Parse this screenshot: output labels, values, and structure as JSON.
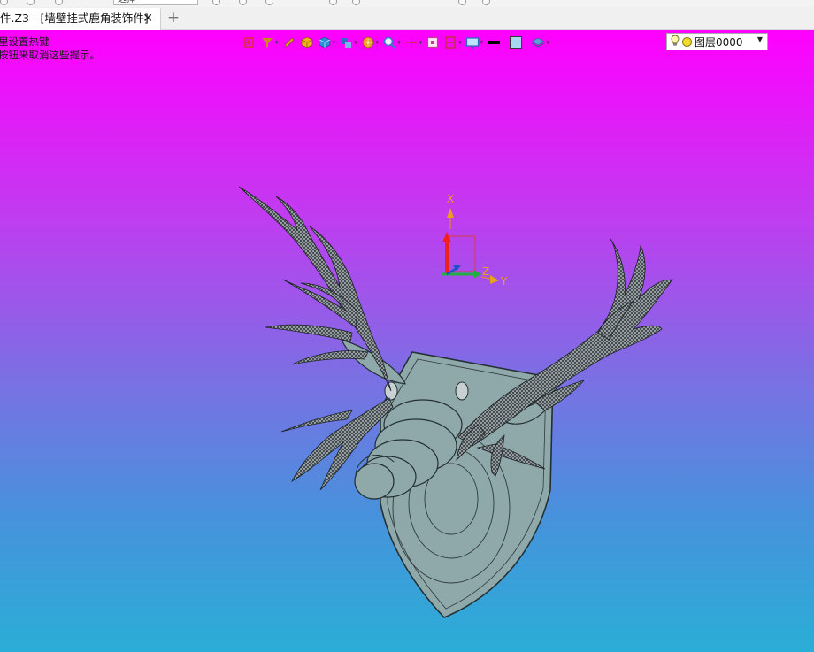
{
  "tab": {
    "title": "件.Z3 - [墙壁挂式鹿角装饰件]",
    "close_glyph": "✕",
    "new_glyph": "+"
  },
  "quickbar": {
    "box_text": "选择"
  },
  "hints": {
    "line1": "里设置热键",
    "line2": "按钮来取消这些提示。"
  },
  "toolbar": {
    "items": [
      {
        "name": "exit-icon",
        "color": "#d9302c",
        "dropdown": false
      },
      {
        "name": "filter-icon",
        "color": "#c98a1c",
        "dropdown": true
      },
      {
        "name": "pencil-icon",
        "color": "#e0a020",
        "dropdown": false
      },
      {
        "name": "cube-yellow-icon",
        "color": "#f0b020",
        "dropdown": false
      },
      {
        "name": "cube-blue-icon",
        "color": "#2a8fd8",
        "dropdown": true
      },
      {
        "name": "views-icon",
        "color": "#2a70c8",
        "dropdown": true
      },
      {
        "name": "render-icon",
        "color": "#f0a020",
        "dropdown": true
      },
      {
        "name": "zoom-icon",
        "color": "#3a78c8",
        "dropdown": true
      },
      {
        "name": "axis-icon",
        "color": "#d03030",
        "dropdown": true
      },
      {
        "name": "frame-icon",
        "color": "#c04090",
        "dropdown": false
      },
      {
        "name": "section-icon",
        "color": "#c03040",
        "dropdown": true
      },
      {
        "name": "display-icon",
        "color": "#2a6ab8",
        "dropdown": true
      },
      {
        "name": "line-style-icon",
        "color": "#000000",
        "dropdown": false
      },
      {
        "name": "color-swatch-icon",
        "color": "#a8d8f0",
        "dropdown": false
      },
      {
        "name": "layer-manager-icon",
        "color": "#5aa0d8",
        "dropdown": true
      }
    ]
  },
  "layer": {
    "name": "图层0000",
    "color": "#f2dc2a"
  },
  "triad": {
    "x_label": "X",
    "y_label": "Y",
    "z_label": "Z"
  },
  "colors": {
    "plaque": "#8fa8aa",
    "plaque_edge": "#233033",
    "antler": "#2b3236",
    "bg_top": "#ff00ff",
    "bg_bottom": "#2aaed6"
  }
}
